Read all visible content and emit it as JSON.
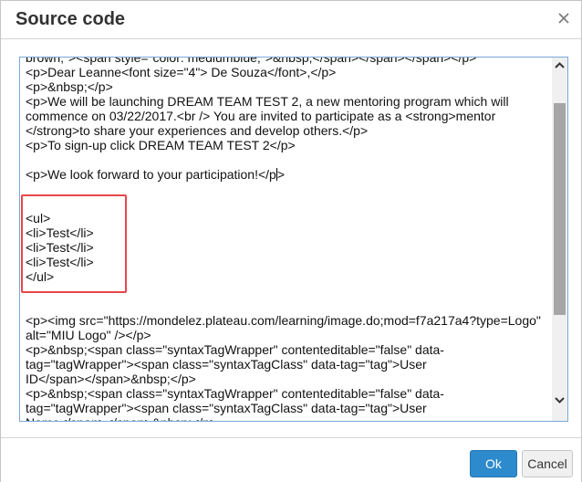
{
  "dialog": {
    "title": "Source code",
    "close_icon": "close-icon"
  },
  "editor": {
    "lines": [
      "brown;\"><span style=\"color: mediumblue;\">&nbsp;</span></span></span></p>",
      "<p>Dear Leanne<font size=\"4\"> De Souza</font>,</p>",
      "<p>&nbsp;</p>",
      "<p>We will be launching DREAM TEAM TEST 2, a new mentoring program which will",
      "commence on 03/22/2017.<br /> You are invited to participate as a <strong>mentor",
      "</strong>to share your experiences and develop others.</p>",
      "<p>To sign-up click DREAM TEAM TEST 2</p>",
      "",
      "<p>We look forward to your participation!</p>",
      "",
      "",
      "<ul>",
      "<li>Test</li>",
      "<li>Test</li>",
      "<li>Test</li>",
      "</ul>",
      "",
      "",
      "<p><img src=\"https://mondelez.plateau.com/learning/image.do;mod=f7a217a4?type=Logo\"",
      "alt=\"MIU Logo\" /></p>",
      "<p>&nbsp;<span class=\"syntaxTagWrapper\" contenteditable=\"false\" data-",
      "tag=\"tagWrapper\"><span class=\"syntaxTagClass\" data-tag=\"tag\">User",
      "ID</span></span>&nbsp;</p>",
      "<p>&nbsp;<span class=\"syntaxTagWrapper\" contenteditable=\"false\" data-",
      "tag=\"tagWrapper\"><span class=\"syntaxTagClass\" data-tag=\"tag\">User",
      "Name</span></span>&nbsp;</p>"
    ],
    "scroll_up_icon": "chevron-up-icon",
    "scroll_down_icon": "chevron-down-icon"
  },
  "footer": {
    "ok_label": "Ok",
    "cancel_label": "Cancel"
  }
}
